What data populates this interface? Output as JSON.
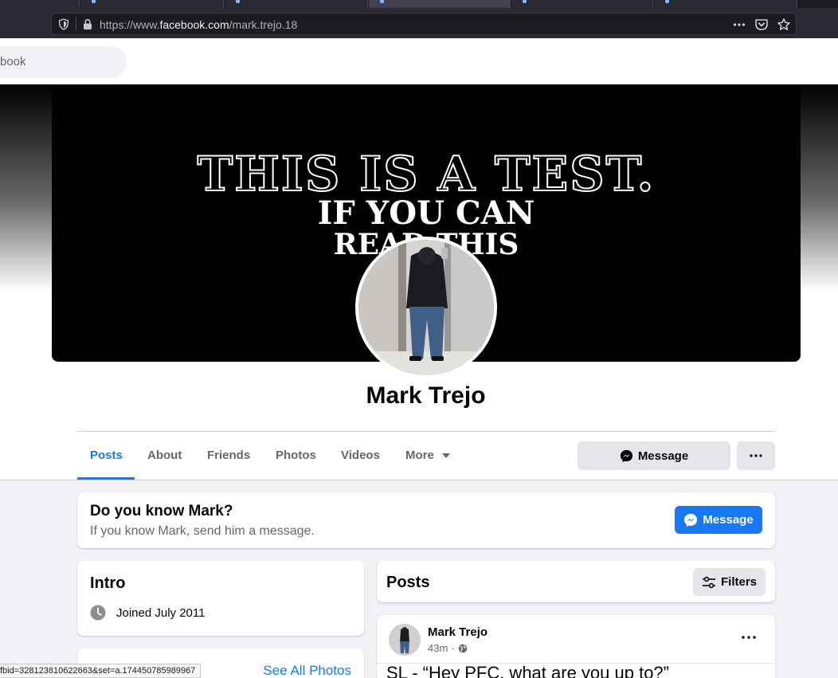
{
  "browser": {
    "tabs": [
      "",
      "",
      "",
      "",
      "",
      ""
    ],
    "url_prefix": "https://www.",
    "url_domain": "facebook.com",
    "url_path": "/mark.trejo.18",
    "status_url": "fbid=328123810622663&set=a.174450785989967"
  },
  "topbar": {
    "search_placeholder": "book"
  },
  "cover": {
    "line1": "THIS IS A TEST.",
    "line2": "IF YOU CAN",
    "line3": "READ THIS"
  },
  "profile": {
    "name": "Mark Trejo",
    "tabs": [
      "Posts",
      "About",
      "Friends",
      "Photos",
      "Videos",
      "More"
    ],
    "message_label": "Message"
  },
  "know_card": {
    "title": "Do you know Mark?",
    "subtitle": "If you know Mark, send him a message.",
    "button_label": "Message"
  },
  "intro": {
    "title": "Intro",
    "joined": "Joined July 2011"
  },
  "photos_card": {
    "see_all": "See All Photos"
  },
  "posts_section": {
    "title": "Posts",
    "filters_label": "Filters"
  },
  "post": {
    "author": "Mark Trejo",
    "time": "43m",
    "separator": "·",
    "text": "SL - “Hey PFC, what are you up to?”"
  },
  "colors": {
    "accent": "#1877f2",
    "page_bg": "#f0f2f5",
    "browser_chrome": "#2b2a33"
  }
}
